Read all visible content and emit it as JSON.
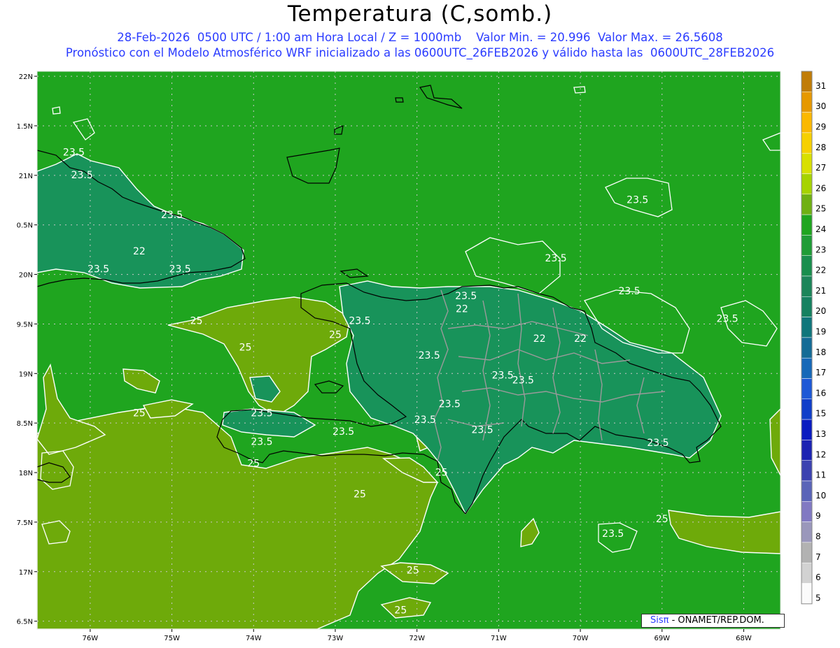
{
  "title": "Temperatura (C,somb.)",
  "subtitle_1": "28-Feb-2026  0500 UTC / 1:00 am Hora Local / Z = 1000mb    Valor Min. = 20.996  Valor Max. = 26.5608",
  "subtitle_2": "Pronóstico con el Modelo Atmosférico WRF inicializado a las 0600UTC_26FEB2026 y válido hasta las  0600UTC_28FEB2026",
  "credit": {
    "sis": "Sis",
    "pi": "π",
    "rest": " - ONAMET/REP.DOM."
  },
  "colors": {
    "sea_green": "#1fa51f",
    "land_dark": "#18935a",
    "warm_olive": "#6eaa0a",
    "contour": "#ffffff",
    "coast": "#000000",
    "provinces": "#9a9a9a",
    "text_blue": "#2b3cff"
  },
  "map": {
    "lat_labels": [
      "22N",
      "1.5N",
      "21N",
      "0.5N",
      "20N",
      "9.5N",
      "19N",
      "8.5N",
      "18N",
      "7.5N",
      "17N",
      "6.5N"
    ],
    "lon_labels": [
      "76W",
      "75W",
      "74W",
      "73W",
      "72W",
      "71W",
      "70W",
      "69W",
      "68W"
    ],
    "contour_labels": [
      {
        "t": "23.5",
        "lon": -76.2,
        "lat": 21.2
      },
      {
        "t": "23.5",
        "lon": -76.1,
        "lat": 20.97
      },
      {
        "t": "23.5",
        "lon": -75.0,
        "lat": 20.57
      },
      {
        "t": "22",
        "lon": -75.4,
        "lat": 20.2
      },
      {
        "t": "23.5",
        "lon": -75.9,
        "lat": 20.02
      },
      {
        "t": "23.5",
        "lon": -74.9,
        "lat": 20.02
      },
      {
        "t": "25",
        "lon": -74.7,
        "lat": 19.5
      },
      {
        "t": "25",
        "lon": -73.0,
        "lat": 19.36
      },
      {
        "t": "25",
        "lon": -74.1,
        "lat": 19.23
      },
      {
        "t": "25",
        "lon": -75.4,
        "lat": 18.57
      },
      {
        "t": "25",
        "lon": -76.8,
        "lat": 18.35
      },
      {
        "t": "23.5",
        "lon": -73.9,
        "lat": 18.57
      },
      {
        "t": "23.5",
        "lon": -73.9,
        "lat": 18.28
      },
      {
        "t": "23.5",
        "lon": -72.9,
        "lat": 18.38
      },
      {
        "t": "25",
        "lon": -74.0,
        "lat": 18.06
      },
      {
        "t": "23.5",
        "lon": -72.7,
        "lat": 19.5
      },
      {
        "t": "23.5",
        "lon": -71.4,
        "lat": 19.75
      },
      {
        "t": "22",
        "lon": -71.45,
        "lat": 19.62
      },
      {
        "t": "23.5",
        "lon": -71.85,
        "lat": 19.15
      },
      {
        "t": "23.5",
        "lon": -71.6,
        "lat": 18.66
      },
      {
        "t": "23.5",
        "lon": -71.9,
        "lat": 18.5
      },
      {
        "t": "23.5",
        "lon": -70.95,
        "lat": 18.95
      },
      {
        "t": "23.5",
        "lon": -70.7,
        "lat": 18.9
      },
      {
        "t": "22",
        "lon": -70.5,
        "lat": 19.32
      },
      {
        "t": "22",
        "lon": -70.0,
        "lat": 19.32
      },
      {
        "t": "23.5",
        "lon": -71.2,
        "lat": 18.4
      },
      {
        "t": "23.5",
        "lon": -70.3,
        "lat": 20.13
      },
      {
        "t": "23.5",
        "lon": -69.4,
        "lat": 19.8
      },
      {
        "t": "23.5",
        "lon": -68.2,
        "lat": 19.52
      },
      {
        "t": "23.5",
        "lon": -69.3,
        "lat": 20.72
      },
      {
        "t": "23.5",
        "lon": -69.05,
        "lat": 18.27
      },
      {
        "t": "25",
        "lon": -71.7,
        "lat": 17.97
      },
      {
        "t": "25",
        "lon": -72.7,
        "lat": 17.75
      },
      {
        "t": "25",
        "lon": -69.0,
        "lat": 17.5
      },
      {
        "t": "23.5",
        "lon": -69.6,
        "lat": 17.35
      },
      {
        "t": "25",
        "lon": -72.05,
        "lat": 16.98
      },
      {
        "t": "25",
        "lon": -72.2,
        "lat": 16.58
      }
    ]
  },
  "colorbar": {
    "labels": [
      "31",
      "30",
      "29",
      "28",
      "27",
      "26",
      "25",
      "24",
      "23",
      "22",
      "21",
      "20",
      "19",
      "18",
      "17",
      "16",
      "15",
      "13",
      "12",
      "11",
      "10",
      "9",
      "8",
      "7",
      "6",
      "5"
    ],
    "colors": [
      "#c07c08",
      "#e69800",
      "#fbb800",
      "#f6d000",
      "#d8e000",
      "#a6d300",
      "#6fb013",
      "#1fa51f",
      "#1f9c36",
      "#198e4d",
      "#1c8559",
      "#168160",
      "#10767b",
      "#146b96",
      "#1668b8",
      "#1d58d6",
      "#103ec9",
      "#0a1bc0",
      "#1c23b2",
      "#3c42b0",
      "#5a64b8",
      "#8179c2",
      "#9a97bb",
      "#b2b2b2",
      "#d2d2d2",
      "#fbfbfb"
    ]
  }
}
